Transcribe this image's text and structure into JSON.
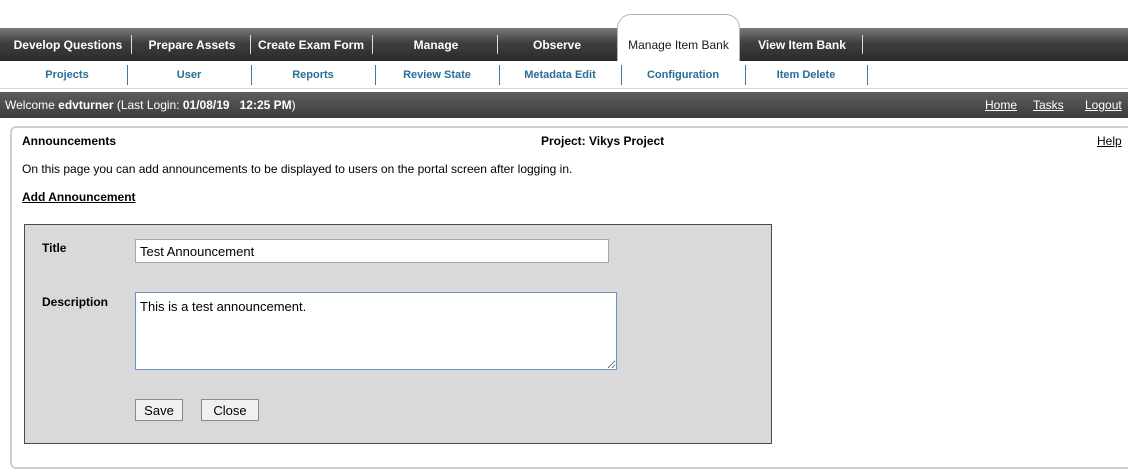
{
  "nav": {
    "tabs": [
      {
        "label": "Develop Questions"
      },
      {
        "label": "Prepare Assets"
      },
      {
        "label": "Create Exam Form"
      },
      {
        "label": "Manage"
      },
      {
        "label": "Observe"
      },
      {
        "label": "Manage Item Bank",
        "active": true
      },
      {
        "label": "View Item Bank"
      }
    ]
  },
  "subnav": {
    "items": [
      {
        "label": "Projects"
      },
      {
        "label": "User"
      },
      {
        "label": "Reports"
      },
      {
        "label": "Review State"
      },
      {
        "label": "Metadata Edit"
      },
      {
        "label": "Configuration"
      },
      {
        "label": "Item Delete"
      }
    ]
  },
  "welcome": {
    "prefix": "Welcome ",
    "username": "edvturner",
    "login_prefix": " (Last Login: ",
    "date": "01/08/19",
    "time": "12:25 PM",
    "login_suffix": ")",
    "links": {
      "home": "Home",
      "tasks": "Tasks",
      "logout": "Logout"
    }
  },
  "panel": {
    "title": "Announcements",
    "project": "Project: Vikys Project",
    "help": "Help",
    "intro": "On this page you can add announcements to be displayed to users on the portal screen after logging in.",
    "add_link": "Add Announcement"
  },
  "form": {
    "title_label": "Title",
    "title_value": "Test Announcement",
    "description_label": "Description",
    "description_value": "This is a test announcement.",
    "save": "Save",
    "close": "Close"
  },
  "colors": {
    "tab_bar": "#3f3f3f",
    "subnav_text": "#2b6e96",
    "welcome_bar": "#4a4a4a",
    "form_bg": "#d9d9d9"
  }
}
